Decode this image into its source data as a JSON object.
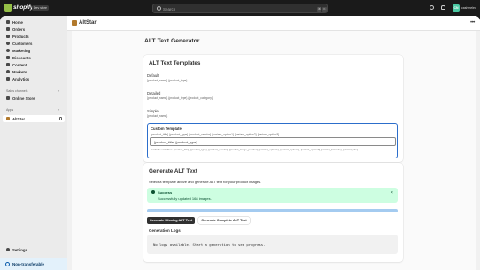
{
  "topbar": {
    "brand": "shopify",
    "badge": "Dev store",
    "search_placeholder": "Search",
    "shortcut": [
      "⌘",
      "K"
    ],
    "avatar_initials": "CN",
    "store_name": "cashmeleo"
  },
  "sidebar": {
    "items": [
      {
        "label": "Home",
        "icon": "home-icon"
      },
      {
        "label": "Orders",
        "icon": "orders-icon"
      },
      {
        "label": "Products",
        "icon": "tag-icon"
      },
      {
        "label": "Customers",
        "icon": "person-icon"
      },
      {
        "label": "Marketing",
        "icon": "target-icon"
      },
      {
        "label": "Discounts",
        "icon": "discount-icon"
      },
      {
        "label": "Content",
        "icon": "content-icon"
      },
      {
        "label": "Markets",
        "icon": "globe-icon"
      },
      {
        "label": "Analytics",
        "icon": "chart-icon"
      }
    ],
    "sales_channels_label": "Sales channels",
    "sales_channels": [
      {
        "label": "Online Store",
        "icon": "store-icon"
      }
    ],
    "apps_label": "Apps",
    "apps": [
      {
        "label": "AltStar",
        "icon": "app-icon"
      }
    ],
    "settings_label": "Settings",
    "nontransferable_label": "Non-transferable"
  },
  "app": {
    "name": "AltStar",
    "page_title": "ALT Text Generator",
    "templates_card": {
      "title": "ALT Text Templates",
      "templates": [
        {
          "name": "Default",
          "pattern": "{product_name} {product_type}"
        },
        {
          "name": "Detailed",
          "pattern": "{product_name} {product_type} {product_category}"
        },
        {
          "name": "Simple",
          "pattern": "{product_name}"
        }
      ],
      "custom": {
        "name": "Custom Template",
        "pattern": "{product_title} {product_type} {product_vendor} {variant_option1} {variant_option2} {variant_option3}",
        "input_value": "{product_title} {product_type}",
        "variables": "Available variables: {product_title}, {product_type}, {product_vendor}, {product_image_position}, {variant_option1}, {variant_option2}, {variant_option3}, {variant_barcode}, {variant_sku}"
      }
    },
    "generate_card": {
      "title": "Generate ALT Text",
      "description": "Select a template above and generate ALT text for your product images.",
      "success_title": "Success",
      "success_message": "Successfully updated 168 images.",
      "progress": 1.0,
      "btn_missing": "Generate Missing ALT Text",
      "btn_complete": "Generate Complete ALT Text",
      "logs_label": "Generation Logs",
      "logs_text": "No logs available. Start a generation to see progress."
    }
  },
  "colors": {
    "accent": "#2c6ecb",
    "success_bg": "#cdfee1",
    "progress_fill": "#a4cbf0",
    "sidebar_bg": "#ebebeb",
    "topbar_bg": "#1a1a1a"
  }
}
